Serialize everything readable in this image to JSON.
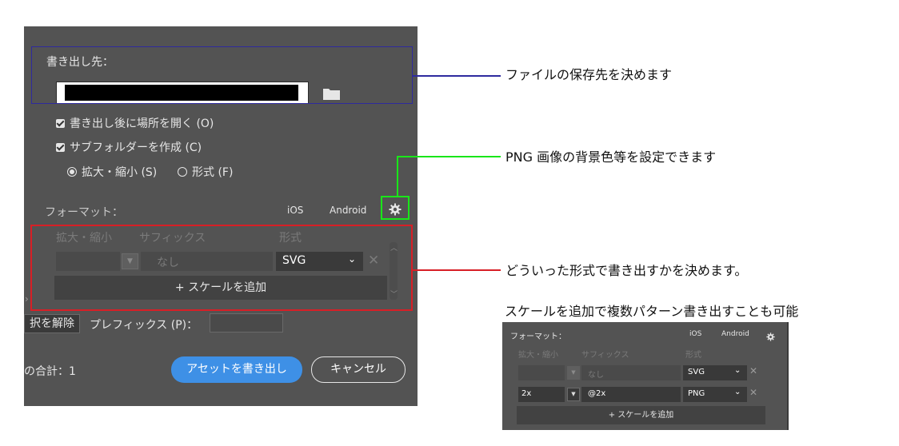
{
  "panel": {
    "export_dest_label": "書き出し先：",
    "open_after_export": "書き出し後に場所を開く (O)",
    "create_subfolder": "サブフォルダーを作成 (C)",
    "scale_option": "拡大・縮小 (S)",
    "format_option": "形式 (F)",
    "format_label": "フォーマット：",
    "ios_label": "iOS",
    "android_label": "Android",
    "col_scale": "拡大・縮小",
    "col_suffix": "サフィックス",
    "col_format": "形式",
    "suffix_placeholder": "なし",
    "format_value": "SVG",
    "add_scale": "+ スケールを追加",
    "deselect": "択を解除",
    "prefix_label": "プレフィックス (P)：",
    "total": "の合計：1",
    "export_button": "アセットを書き出し",
    "cancel_button": "キャンセル"
  },
  "callouts": {
    "save_dest": "ファイルの保存先を決めます",
    "png_bg": "PNG 画像の背景色等を設定できます",
    "format_choice": "どういった形式で書き出すかを決めます。",
    "add_scale_note": "スケールを追加で複数パターン書き出すことも可能"
  },
  "mini": {
    "format_label": "フォーマット：",
    "ios_label": "iOS",
    "android_label": "Android",
    "col_scale": "拡大・縮小",
    "col_suffix": "サフィックス",
    "col_format": "形式",
    "row1": {
      "scale": "",
      "suffix": "なし",
      "format": "SVG"
    },
    "row2": {
      "scale": "2x",
      "suffix": "@2x",
      "format": "PNG"
    },
    "add_scale": "+ スケールを追加"
  },
  "colors": {
    "blue_box": "#2e2a9e",
    "green_box": "#19e619",
    "red_box": "#d81f26",
    "export_blue": "#3e90e6"
  }
}
